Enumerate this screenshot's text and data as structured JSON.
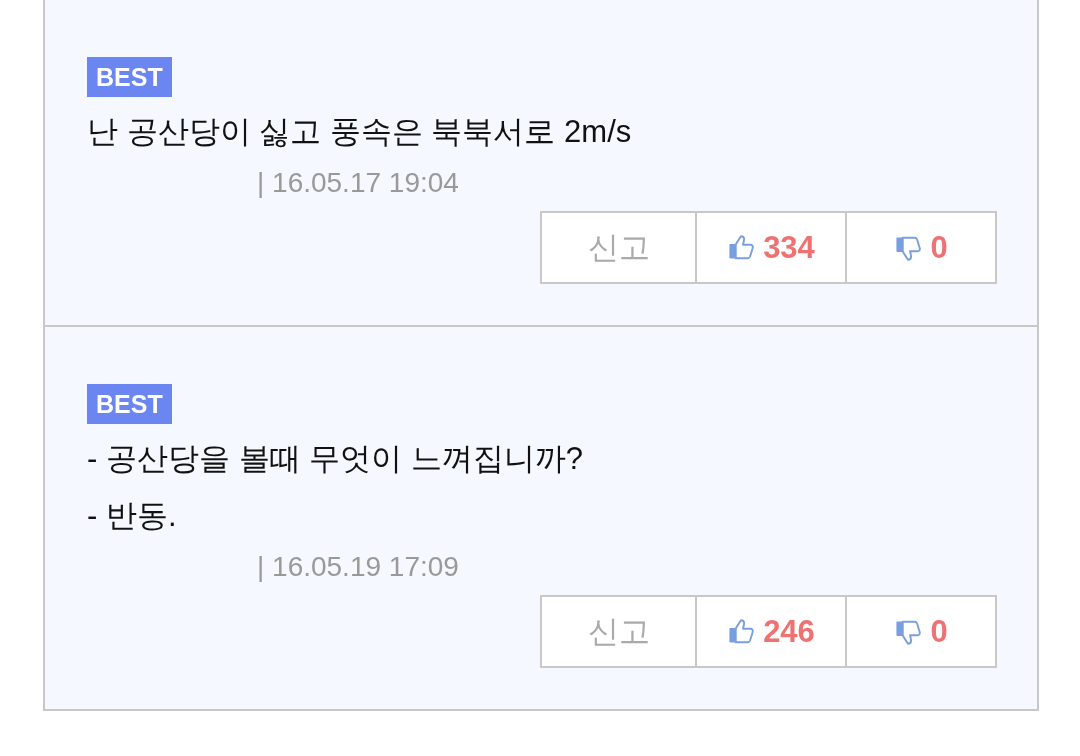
{
  "comments": [
    {
      "badge": "BEST",
      "lines": [
        "난 공산당이 싫고 풍속은 북북서로 2m/s"
      ],
      "meta": "| 16.05.17 19:04",
      "report": "신고",
      "likes": "334",
      "dislikes": "0"
    },
    {
      "badge": "BEST",
      "lines": [
        "- 공산당을 볼때 무엇이 느껴집니까?",
        "- 반동."
      ],
      "meta": "| 16.05.19 17:09",
      "report": "신고",
      "likes": "246",
      "dislikes": "0"
    }
  ]
}
